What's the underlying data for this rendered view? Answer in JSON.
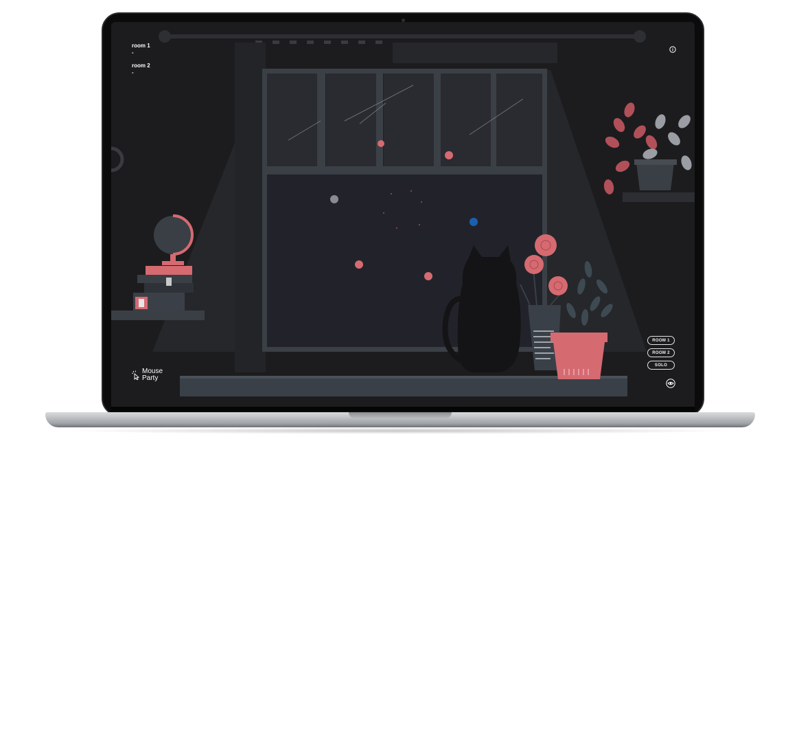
{
  "rooms_panel": {
    "rooms": [
      {
        "name": "room 1",
        "value": "-"
      },
      {
        "name": "room 2",
        "value": "-"
      }
    ]
  },
  "room_buttons": {
    "room1": "ROOM 1",
    "room2": "ROOM 2",
    "solo": "SOLO"
  },
  "logo": {
    "line1": "Mouse",
    "line2": "Party"
  },
  "icons": {
    "info": "info-icon",
    "eye": "eye-icon",
    "logo": "cursor-sparkle-icon"
  },
  "colors": {
    "accent_pink": "#d66a71",
    "cursor_blue": "#1b5fb3",
    "cursor_gray": "#8a8a90",
    "scene_dark": "#1c1c1e"
  }
}
